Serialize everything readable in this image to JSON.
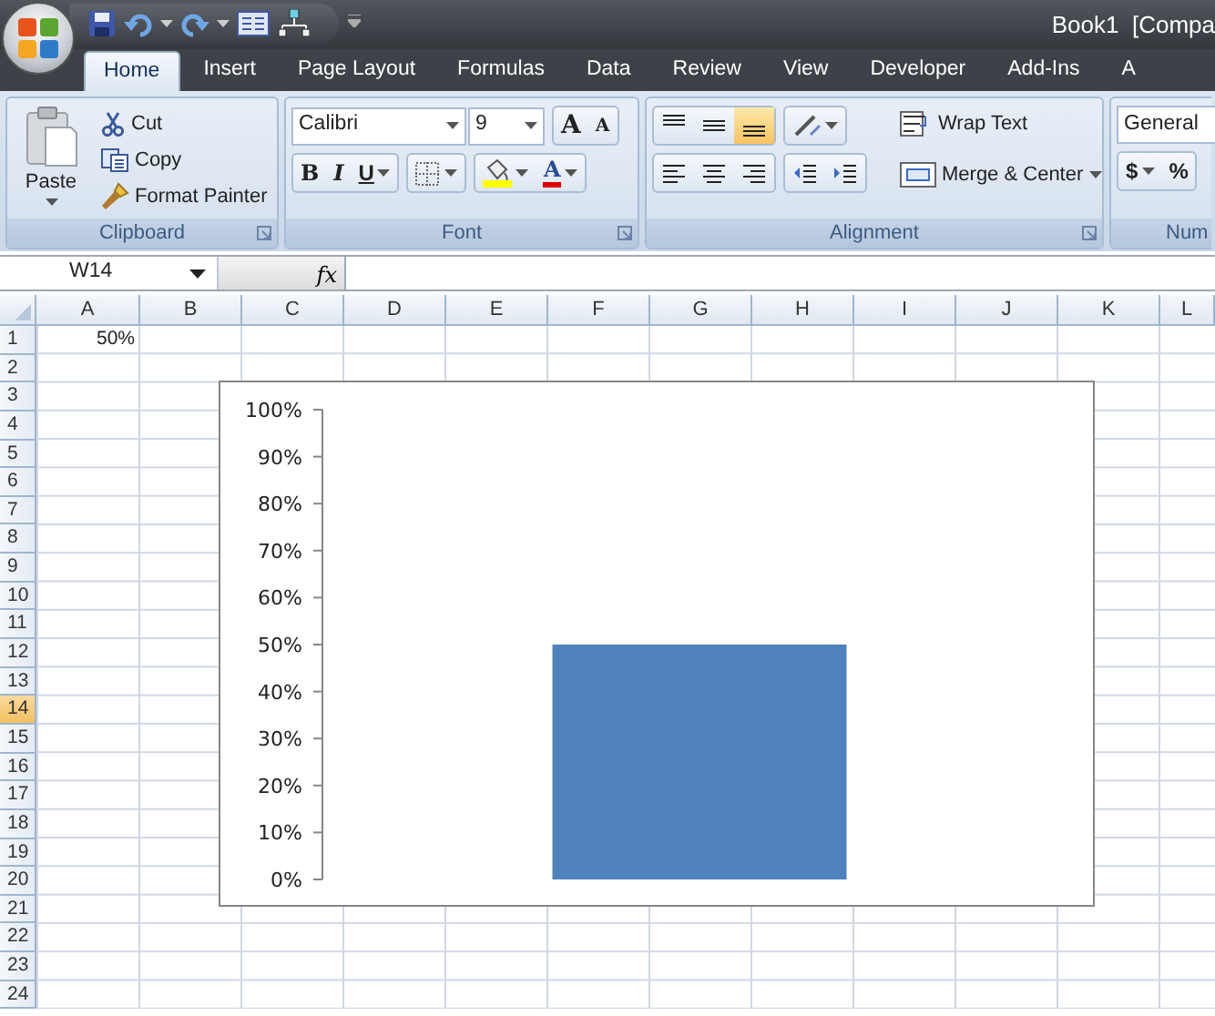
{
  "title_bar": {
    "title": "Book1  [Compa"
  },
  "tabs": [
    {
      "label": "Home",
      "selected": true
    },
    {
      "label": "Insert",
      "selected": false
    },
    {
      "label": "Page Layout",
      "selected": false
    },
    {
      "label": "Formulas",
      "selected": false
    },
    {
      "label": "Data",
      "selected": false
    },
    {
      "label": "Review",
      "selected": false
    },
    {
      "label": "View",
      "selected": false
    },
    {
      "label": "Developer",
      "selected": false
    },
    {
      "label": "Add-Ins",
      "selected": false
    },
    {
      "label": "A",
      "selected": false
    }
  ],
  "clipboard": {
    "label": "Clipboard",
    "paste": "Paste",
    "cut": "Cut",
    "copy": "Copy",
    "format_painter": "Format Painter"
  },
  "font": {
    "label": "Font",
    "font_name": "Calibri",
    "font_size": "9",
    "grow_font": "A",
    "shrink_font": "A",
    "bold": "B",
    "italic": "I",
    "underline": "U",
    "font_color": "A"
  },
  "alignment": {
    "label": "Alignment",
    "vertical_align": [
      {
        "kind": "top",
        "selected": false
      },
      {
        "kind": "middle",
        "selected": false
      },
      {
        "kind": "bottom",
        "selected": true
      }
    ],
    "wrap_text": "Wrap Text",
    "merge_center": "Merge & Center"
  },
  "number": {
    "label": "Num",
    "format": "General",
    "currency": "$",
    "percent": "%"
  },
  "formula_bar": {
    "name_box": "W14",
    "function_label": "fx"
  },
  "sheet": {
    "columns": [
      {
        "label": "A",
        "selected": false
      },
      {
        "label": "B",
        "selected": false
      },
      {
        "label": "C",
        "selected": false
      },
      {
        "label": "D",
        "selected": false
      },
      {
        "label": "E",
        "selected": false
      },
      {
        "label": "F",
        "selected": false
      },
      {
        "label": "G",
        "selected": false
      },
      {
        "label": "H",
        "selected": false
      },
      {
        "label": "I",
        "selected": false
      },
      {
        "label": "J",
        "selected": false
      },
      {
        "label": "K",
        "selected": false
      },
      {
        "label": "L",
        "selected": false
      }
    ],
    "rows": [
      {
        "label": "1",
        "selected": false,
        "cells": [
          "50%"
        ]
      },
      {
        "label": "2",
        "selected": false
      },
      {
        "label": "3",
        "selected": false
      },
      {
        "label": "4",
        "selected": false
      },
      {
        "label": "5",
        "selected": false
      },
      {
        "label": "6",
        "selected": false
      },
      {
        "label": "7",
        "selected": false
      },
      {
        "label": "8",
        "selected": false
      },
      {
        "label": "9",
        "selected": false
      },
      {
        "label": "10",
        "selected": false
      },
      {
        "label": "11",
        "selected": false
      },
      {
        "label": "12",
        "selected": false
      },
      {
        "label": "13",
        "selected": false
      },
      {
        "label": "14",
        "selected": true
      },
      {
        "label": "15",
        "selected": false
      },
      {
        "label": "16",
        "selected": false
      },
      {
        "label": "17",
        "selected": false
      },
      {
        "label": "18",
        "selected": false
      },
      {
        "label": "19",
        "selected": false
      },
      {
        "label": "20",
        "selected": false
      },
      {
        "label": "21",
        "selected": false
      },
      {
        "label": "22",
        "selected": false
      },
      {
        "label": "23",
        "selected": false
      },
      {
        "label": "24",
        "selected": false
      }
    ]
  },
  "chart": {
    "chart_data": {
      "type": "bar",
      "series": [
        {
          "color": "#4f81bd",
          "values": [
            50
          ]
        }
      ],
      "ylim": [
        0,
        100
      ],
      "yticks": [
        {
          "value": 0,
          "label": "0%"
        },
        {
          "value": 10,
          "label": "10%"
        },
        {
          "value": 20,
          "label": "20%"
        },
        {
          "value": 30,
          "label": "30%"
        },
        {
          "value": 40,
          "label": "40%"
        },
        {
          "value": 50,
          "label": "50%"
        },
        {
          "value": 60,
          "label": "60%"
        },
        {
          "value": 70,
          "label": "70%"
        },
        {
          "value": 80,
          "label": "80%"
        },
        {
          "value": 90,
          "label": "90%"
        },
        {
          "value": 100,
          "label": "100%"
        }
      ]
    }
  }
}
